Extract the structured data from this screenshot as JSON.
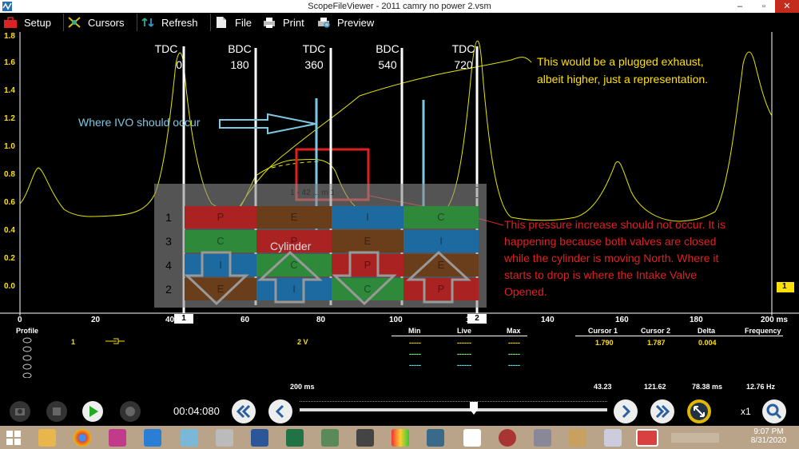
{
  "window": {
    "title": "ScopeFileViewer - 2011 camry no power 2.vsm",
    "min_glyph": "–",
    "max_glyph": "▫",
    "close_glyph": "✕"
  },
  "toolbar": {
    "setup": "Setup",
    "cursors": "Cursors",
    "refresh": "Refresh",
    "file": "File",
    "print": "Print",
    "preview": "Preview"
  },
  "y_ticks": [
    "1.8",
    "1.6",
    "1.4",
    "1.2",
    "1.0",
    "0.8",
    "0.6",
    "0.4",
    "0.2",
    "0.0"
  ],
  "x_ticks": [
    "0",
    "20",
    "40",
    "60",
    "80",
    "100",
    "120",
    "140",
    "160",
    "180",
    "200 ms"
  ],
  "cursor_tabs": {
    "c1": "1",
    "c2": "2"
  },
  "marker_right": "1",
  "stroke_labels": [
    {
      "name": "TDC",
      "deg": "0"
    },
    {
      "name": "BDC",
      "deg": "180"
    },
    {
      "name": "TDC",
      "deg": "360"
    },
    {
      "name": "BDC",
      "deg": "540"
    },
    {
      "name": "TDC",
      "deg": "720"
    }
  ],
  "annotations": {
    "ivo": "Where IVO should occur",
    "plugged_line1": "This would be a plugged exhaust,",
    "plugged_line2": "albeit higher, just a representation.",
    "pressure_line1": "This pressure increase should not occur. It is",
    "pressure_line2": "happening because both valves are closed",
    "pressure_line3": "while the cylinder is moving North. Where it",
    "pressure_line4": "starts to drop is where the Intake Valve",
    "pressure_line5": "Opened."
  },
  "overlay": {
    "header": "1 - 42 ... m 1",
    "cylinder_label": "Cylinder",
    "rows": [
      {
        "num": "1",
        "cells": [
          "P",
          "E",
          "I",
          "C"
        ]
      },
      {
        "num": "3",
        "cells": [
          "C",
          "P",
          "E",
          "I"
        ]
      },
      {
        "num": "4",
        "cells": [
          "I",
          "C",
          "P",
          "E"
        ]
      },
      {
        "num": "2",
        "cells": [
          "E",
          "I",
          "C",
          "P"
        ]
      }
    ]
  },
  "info": {
    "profile": "Profile",
    "channel_num": "1",
    "scale": "2 V",
    "min": "Min",
    "live": "Live",
    "max": "Max",
    "cursor1": "Cursor 1",
    "cursor2": "Cursor 2",
    "delta": "Delta",
    "frequency": "Frequency",
    "cursor1_val": "1.790",
    "cursor2_val": "1.787",
    "delta_val": "0.004",
    "dash_short": "-----",
    "dash_long": "------",
    "timebase": "200 ms",
    "c1_time": "43.23",
    "c2_time": "121.62",
    "delta_time": "78.38 ms",
    "freq_val": "12.76 Hz"
  },
  "playback": {
    "time": "00:04:080",
    "zoom": "x1"
  },
  "taskbar": {
    "time": "9:07 PM",
    "date": "8/31/2020"
  },
  "colors": {
    "trace": "#e6e600",
    "annotation_yellow": "#ffe000",
    "annotation_blue": "#7ec8e3",
    "annotation_red": "#e02020"
  }
}
